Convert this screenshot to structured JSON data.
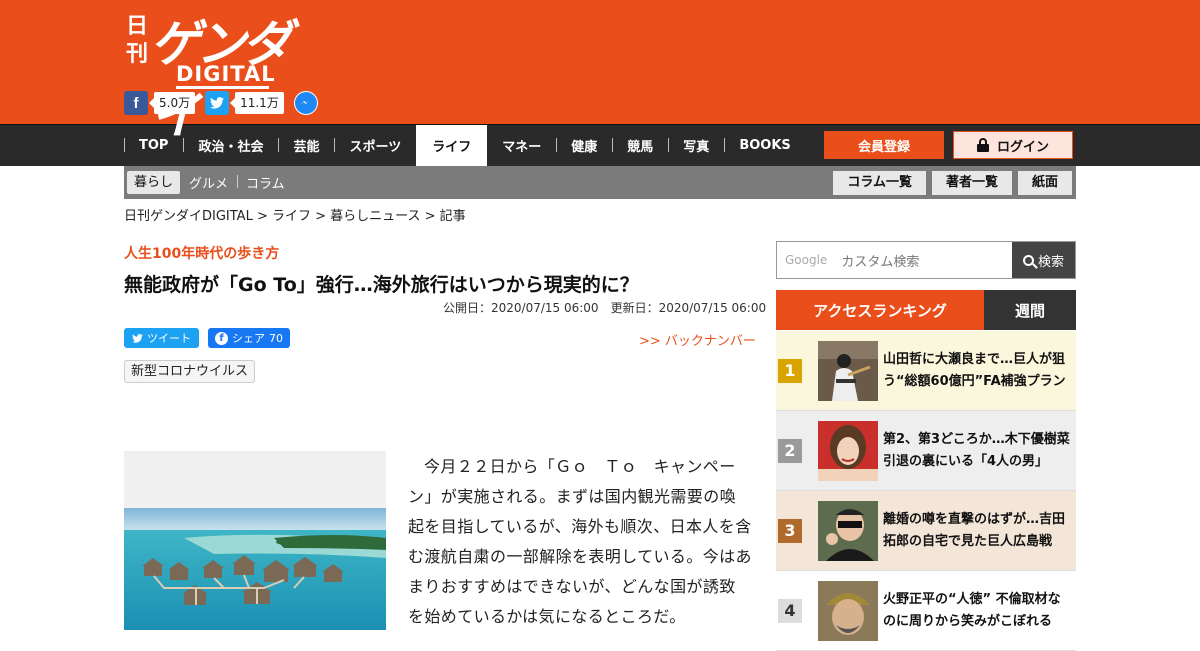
{
  "header": {
    "logo_kan": "日刊",
    "logo_main": "ゲンダイ",
    "logo_sub": "DIGITAL",
    "facebook_count": "5.0万",
    "twitter_count": "11.1万",
    "brand_color": "#e94e1b"
  },
  "nav": {
    "items": [
      "TOP",
      "政治・社会",
      "芸能",
      "スポーツ",
      "ライフ",
      "マネー",
      "健康",
      "競馬",
      "写真",
      "BOOKS"
    ],
    "active": "ライフ",
    "register_label": "会員登録",
    "login_label": "ログイン"
  },
  "subnav": {
    "items": [
      "暮らし",
      "グルメ",
      "コラム"
    ],
    "buttons": [
      "コラム一覧",
      "著者一覧",
      "紙面"
    ]
  },
  "breadcrumb": "日刊ゲンダイDIGITAL > ライフ > 暮らしニュース > 記事",
  "article": {
    "kicker": "人生100年時代の歩き方",
    "title": "無能政府が「Go To」強行…海外旅行はいつから現実的に？",
    "published": "公開日：2020/07/15 06:00",
    "updated": "更新日：2020/07/15 06:00",
    "tweet_label": "ツイート",
    "share_label": "シェア",
    "share_count": "70",
    "back_number": ">> バックナンバー",
    "tag": "新型コロナウイルス",
    "body": "今月２２日から「Ｇｏ　Ｔｏ　キャンペーン」が実施される。まずは国内観光需要の喚起を目指しているが、海外も順次、日本人を含む渡航自粛の一部解除を表明している。今はあまりおすすめはできないが、どんな国が誘致を始めているかは気になるところだ。"
  },
  "sidebar": {
    "search_brand": "Google",
    "search_placeholder": "カスタム検索",
    "search_button": "検索",
    "ranking_title": "アクセスランキング",
    "ranking_period": "週間",
    "ranking": [
      {
        "rank": "1",
        "text": "山田哲に大瀬良まで…巨人が狙う“総額60億円”FA補強プラン",
        "badge_color": "#d9a400",
        "bg": "#fbf7dd"
      },
      {
        "rank": "2",
        "text": "第2、第3どころか…木下優樹菜引退の裏にいる「4人の男」",
        "badge_color": "#9a9a9a",
        "bg": "#eeeeee"
      },
      {
        "rank": "3",
        "text": "離婚の噂を直撃のはずが…吉田拓郎の自宅で見た巨人広島戦",
        "badge_color": "#b06a2c",
        "bg": "#f3e6d8"
      },
      {
        "rank": "4",
        "text": "火野正平の“人徳” 不倫取材なのに周りから笑みがこぼれる",
        "badge_color": "#dddddd",
        "bg": "#ffffff"
      }
    ]
  }
}
